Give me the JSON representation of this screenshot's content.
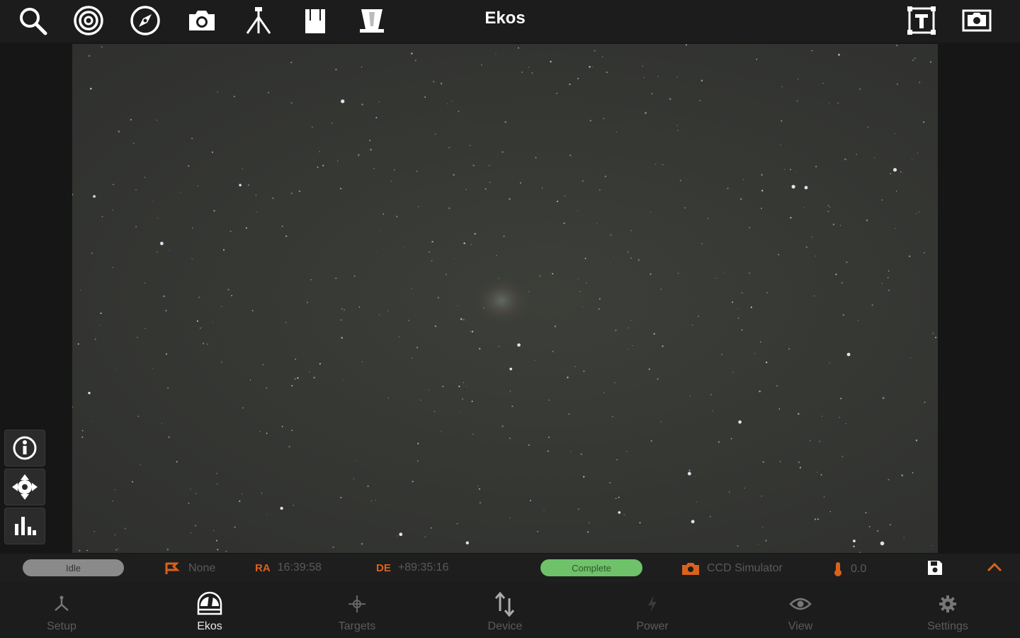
{
  "header": {
    "title": "Ekos",
    "toolbar_left": [
      "search-icon",
      "target-icon",
      "compass-icon",
      "camera-icon",
      "tripod-icon",
      "filter-wheel-icon",
      "dome-icon"
    ],
    "toolbar_right": [
      "frame-icon",
      "capture-frame-icon"
    ]
  },
  "side_buttons": [
    "info-icon",
    "crosshair-icon",
    "histogram-icon"
  ],
  "status": {
    "state": "Idle",
    "target": "None",
    "ra_label": "RA",
    "ra_value": "16:39:58",
    "de_label": "DE",
    "de_value": "+89:35:16",
    "capture_status": "Complete",
    "camera": "CCD Simulator",
    "temperature": "0.0",
    "colors": {
      "accent": "#d9621c",
      "complete": "#6fc16a",
      "idle": "#8a8a8a"
    }
  },
  "nav": [
    {
      "label": "Setup",
      "icon": "setup-icon"
    },
    {
      "label": "Ekos",
      "icon": "ekos-dome-icon",
      "active": true
    },
    {
      "label": "Targets",
      "icon": "targets-icon"
    },
    {
      "label": "Device",
      "icon": "device-icon"
    },
    {
      "label": "Power",
      "icon": "power-icon"
    },
    {
      "label": "View",
      "icon": "eye-icon"
    },
    {
      "label": "Settings",
      "icon": "gear-icon"
    }
  ]
}
